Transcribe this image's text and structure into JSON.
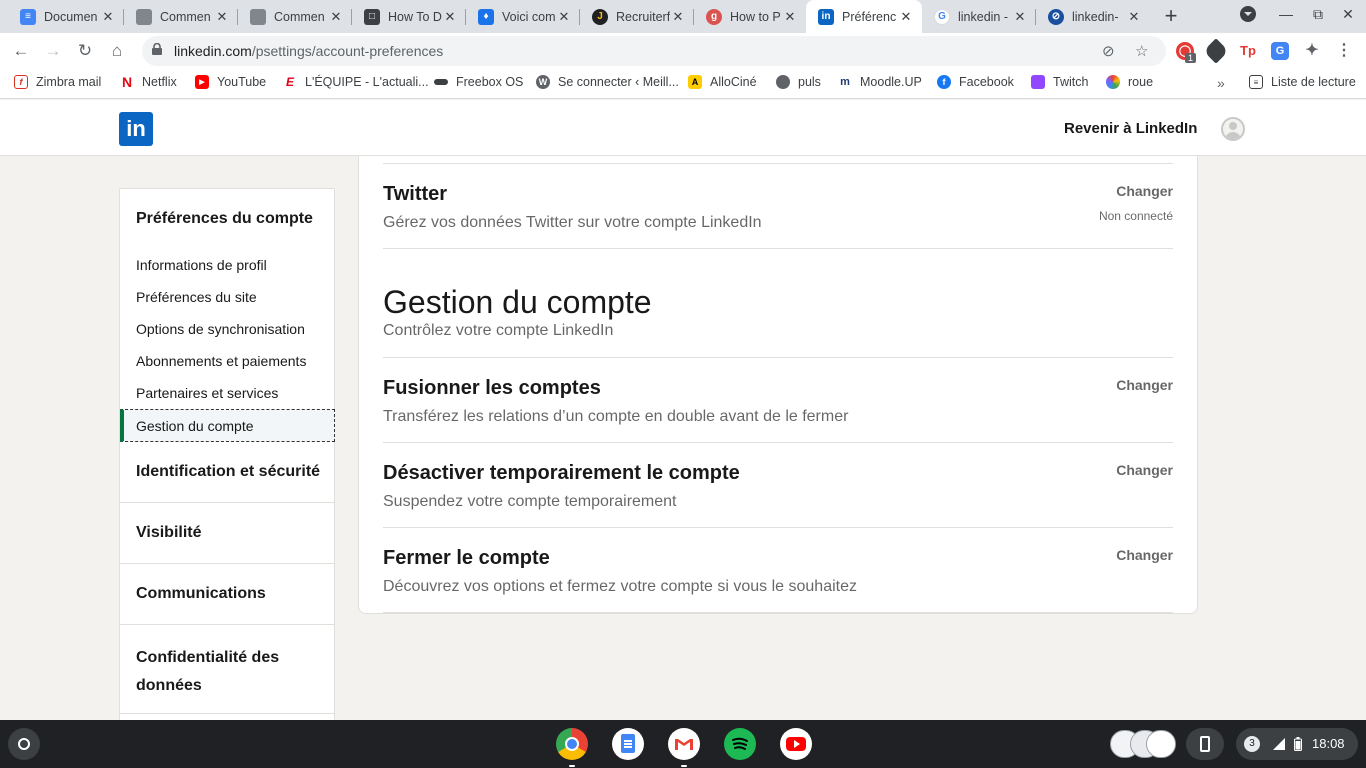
{
  "browser": {
    "tabs": [
      {
        "title": "Documen",
        "favicon": "docs-icon",
        "color": "#4285f4"
      },
      {
        "title": "Commen",
        "favicon": "comment-icon",
        "color": "#80868b"
      },
      {
        "title": "Commen",
        "favicon": "comment-icon",
        "color": "#80868b"
      },
      {
        "title": "How To D",
        "favicon": "howto-icon",
        "color": "#3c4043"
      },
      {
        "title": "Voici com",
        "favicon": "drop-icon",
        "color": "#1a73e8"
      },
      {
        "title": "Recruiterf",
        "favicon": "recruiter-icon",
        "color": "#202124"
      },
      {
        "title": "How to P",
        "favicon": "g-icon",
        "color": "#d9534f"
      },
      {
        "title": "Préférenc",
        "favicon": "linkedin-icon",
        "color": "#0a66c2"
      },
      {
        "title": "linkedin -",
        "favicon": "google-icon",
        "color": "#4285f4"
      },
      {
        "title": "linkedin-",
        "favicon": "compass-icon",
        "color": "#1a4fa0"
      }
    ],
    "active_tab": 7,
    "url_domain": "linkedin.com",
    "url_path": "/psettings/account-preferences",
    "bookmarks": [
      {
        "label": "Zimbra mail",
        "icon": "zimbra-icon",
        "color": "#d93025"
      },
      {
        "label": "Netflix",
        "icon": "netflix-icon",
        "color": "#e50914"
      },
      {
        "label": "YouTube",
        "icon": "youtube-icon",
        "color": "#ff0000"
      },
      {
        "label": "L'ÉQUIPE - L'actuali...",
        "icon": "lequipe-icon",
        "color": "#e2001a"
      },
      {
        "label": "Freebox OS",
        "icon": "freebox-icon",
        "color": "#3c4043"
      },
      {
        "label": "Se connecter ‹ Meill...",
        "icon": "wordpress-icon",
        "color": "#5f6368"
      },
      {
        "label": "AlloCiné",
        "icon": "allocine-icon",
        "color": "#fecc00"
      },
      {
        "label": "puls",
        "icon": "globe-icon",
        "color": "#5f6368"
      },
      {
        "label": "Moodle.UP",
        "icon": "moodle-icon",
        "color": "#1f3b73"
      },
      {
        "label": "Facebook",
        "icon": "facebook-icon",
        "color": "#1877f2"
      },
      {
        "label": "Twitch",
        "icon": "twitch-icon",
        "color": "#9146ff"
      },
      {
        "label": "roue",
        "icon": "wheel-icon",
        "color": "#7b61ff"
      }
    ],
    "reading_list": "Liste de lecture",
    "extension_badge": "1"
  },
  "header": {
    "logo": "in",
    "back_link": "Revenir à LinkedIn"
  },
  "sidebar": {
    "section_title": "Préférences du compte",
    "items": [
      "Informations de profil",
      "Préférences du site",
      "Options de synchronisation",
      "Abonnements et paiements",
      "Partenaires et services",
      "Gestion du compte"
    ],
    "active_item": "Gestion du compte",
    "sections": [
      "Identification et sécurité",
      "Visibilité",
      "Communications",
      "Confidentialité des données"
    ]
  },
  "main": {
    "twitter": {
      "title": "Twitter",
      "description": "Gérez vos données Twitter sur votre compte LinkedIn",
      "action": "Changer",
      "status": "Non connecté"
    },
    "section": {
      "title": "Gestion du compte",
      "subtitle": "Contrôlez votre compte LinkedIn"
    },
    "rows": [
      {
        "title": "Fusionner les comptes",
        "description": "Transférez les relations d’un compte en double avant de le fermer",
        "action": "Changer"
      },
      {
        "title": "Désactiver temporairement le compte",
        "description": "Suspendez votre compte temporairement",
        "action": "Changer"
      },
      {
        "title": "Fermer le compte",
        "description": "Découvrez vos options et fermez votre compte si vous le souhaitez",
        "action": "Changer"
      }
    ]
  },
  "shelf": {
    "apps": [
      "chrome-icon",
      "docs-icon",
      "gmail-icon",
      "spotify-icon",
      "youtube-icon"
    ],
    "notification_count": "3",
    "time": "18:08"
  }
}
